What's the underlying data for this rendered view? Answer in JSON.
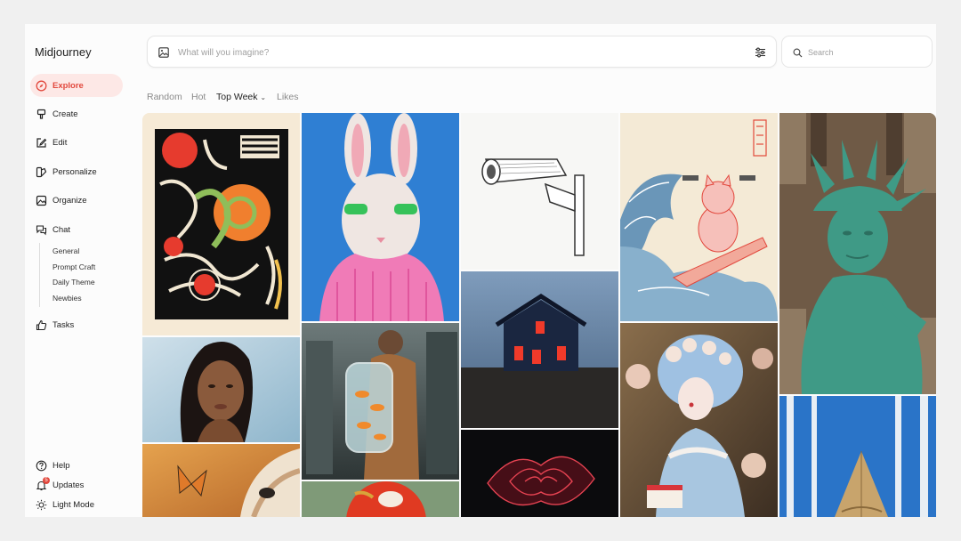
{
  "app": {
    "title": "Midjourney"
  },
  "sidebar": {
    "items": [
      {
        "label": "Explore",
        "icon": "compass-icon"
      },
      {
        "label": "Create",
        "icon": "brush-icon"
      },
      {
        "label": "Edit",
        "icon": "pencil-square-icon"
      },
      {
        "label": "Personalize",
        "icon": "palette-icon"
      },
      {
        "label": "Organize",
        "icon": "image-icon"
      },
      {
        "label": "Chat",
        "icon": "chat-bubbles-icon"
      },
      {
        "label": "Tasks",
        "icon": "thumbs-up-icon"
      }
    ],
    "chat_channels": [
      "General",
      "Prompt Craft",
      "Daily Theme",
      "Newbies"
    ],
    "bottom": [
      {
        "label": "Help",
        "icon": "question-circle-icon"
      },
      {
        "label": "Updates",
        "icon": "bell-icon",
        "badge": "5"
      },
      {
        "label": "Light Mode",
        "icon": "sun-icon"
      }
    ]
  },
  "prompt": {
    "placeholder": "What will you imagine?",
    "image_icon": "image-upload-icon",
    "settings_icon": "sliders-icon"
  },
  "search": {
    "placeholder": "Search",
    "icon": "search-icon"
  },
  "filters": {
    "tabs": [
      "Random",
      "Hot",
      "Top Week",
      "Likes"
    ],
    "active": "Top Week"
  },
  "colors": {
    "accent": "#e2483d",
    "accent_bg": "#fde8e6",
    "muted_text": "#8a8a8a"
  },
  "gallery": {
    "tiles": [
      "abstract-bold-pattern-image",
      "rabbit-pink-sweater-image",
      "security-camera-sketch-image",
      "surfing-cat-wave-image",
      "statue-of-liberty-city-image",
      "woman-portrait-image",
      "man-fish-backpack-image",
      "house-red-windows-image",
      "marie-antoinette-cake-image",
      "fox-butterfly-image",
      "red-rose-xray-image",
      "bird-red-circle-image",
      "snow-forest-tent-image"
    ]
  }
}
